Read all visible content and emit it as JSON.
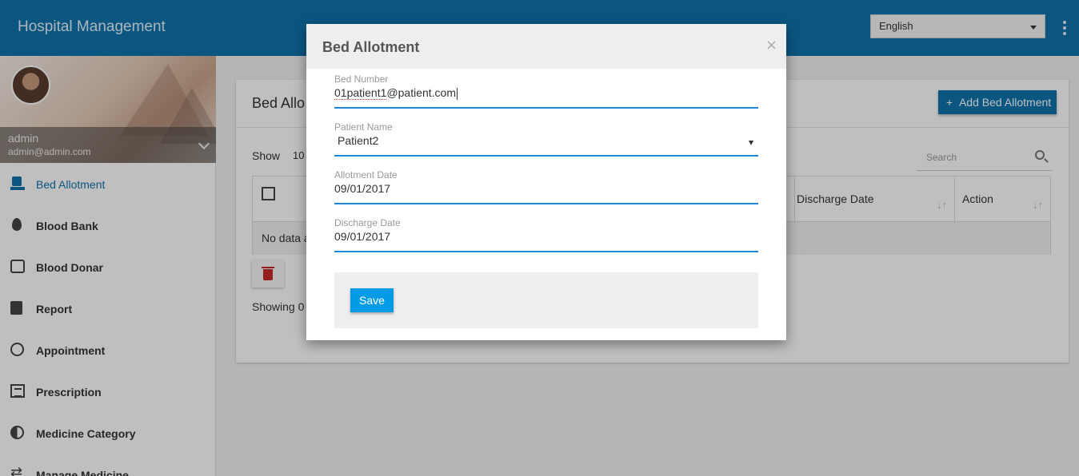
{
  "app": {
    "title": "Hospital Management",
    "language": "English"
  },
  "user": {
    "name": "admin",
    "email": "admin@admin.com"
  },
  "sidebar": {
    "items": [
      {
        "label": "Bed Allotment",
        "icon": "bed-icon",
        "active": true
      },
      {
        "label": "Blood Bank",
        "icon": "blood-drop-icon"
      },
      {
        "label": "Blood Donar",
        "icon": "donor-card-icon"
      },
      {
        "label": "Report",
        "icon": "book-icon"
      },
      {
        "label": "Appointment",
        "icon": "gauge-icon"
      },
      {
        "label": "Prescription",
        "icon": "list-icon"
      },
      {
        "label": "Medicine Category",
        "icon": "half-circle-icon"
      },
      {
        "label": "Manage Medicine",
        "icon": "swap-arrows-icon"
      }
    ]
  },
  "page": {
    "title": "Bed Allo",
    "add_button": "Add Bed Allotment",
    "show_label": "Show",
    "show_value": "10",
    "search_placeholder": "Search",
    "columns": [
      "Discharge Date",
      "Action"
    ],
    "empty_text": "No data a",
    "showing_text": "Showing 0"
  },
  "modal": {
    "title": "Bed Allotment",
    "close": "×",
    "fields": {
      "bed_number": {
        "label": "Bed Number",
        "value_misspelled": "01patient1",
        "value_rest": "@patient.com"
      },
      "patient_name": {
        "label": "Patient Name",
        "value": "Patient2"
      },
      "allotment_date": {
        "label": "Allotment Date",
        "value": "09/01/2017"
      },
      "discharge_date": {
        "label": "Discharge Date",
        "value": "09/01/2017"
      }
    },
    "save_label": "Save"
  },
  "colors": {
    "primary": "#0f73ad",
    "accent": "#1e88d9",
    "save": "#039be5",
    "danger": "#c62828"
  }
}
